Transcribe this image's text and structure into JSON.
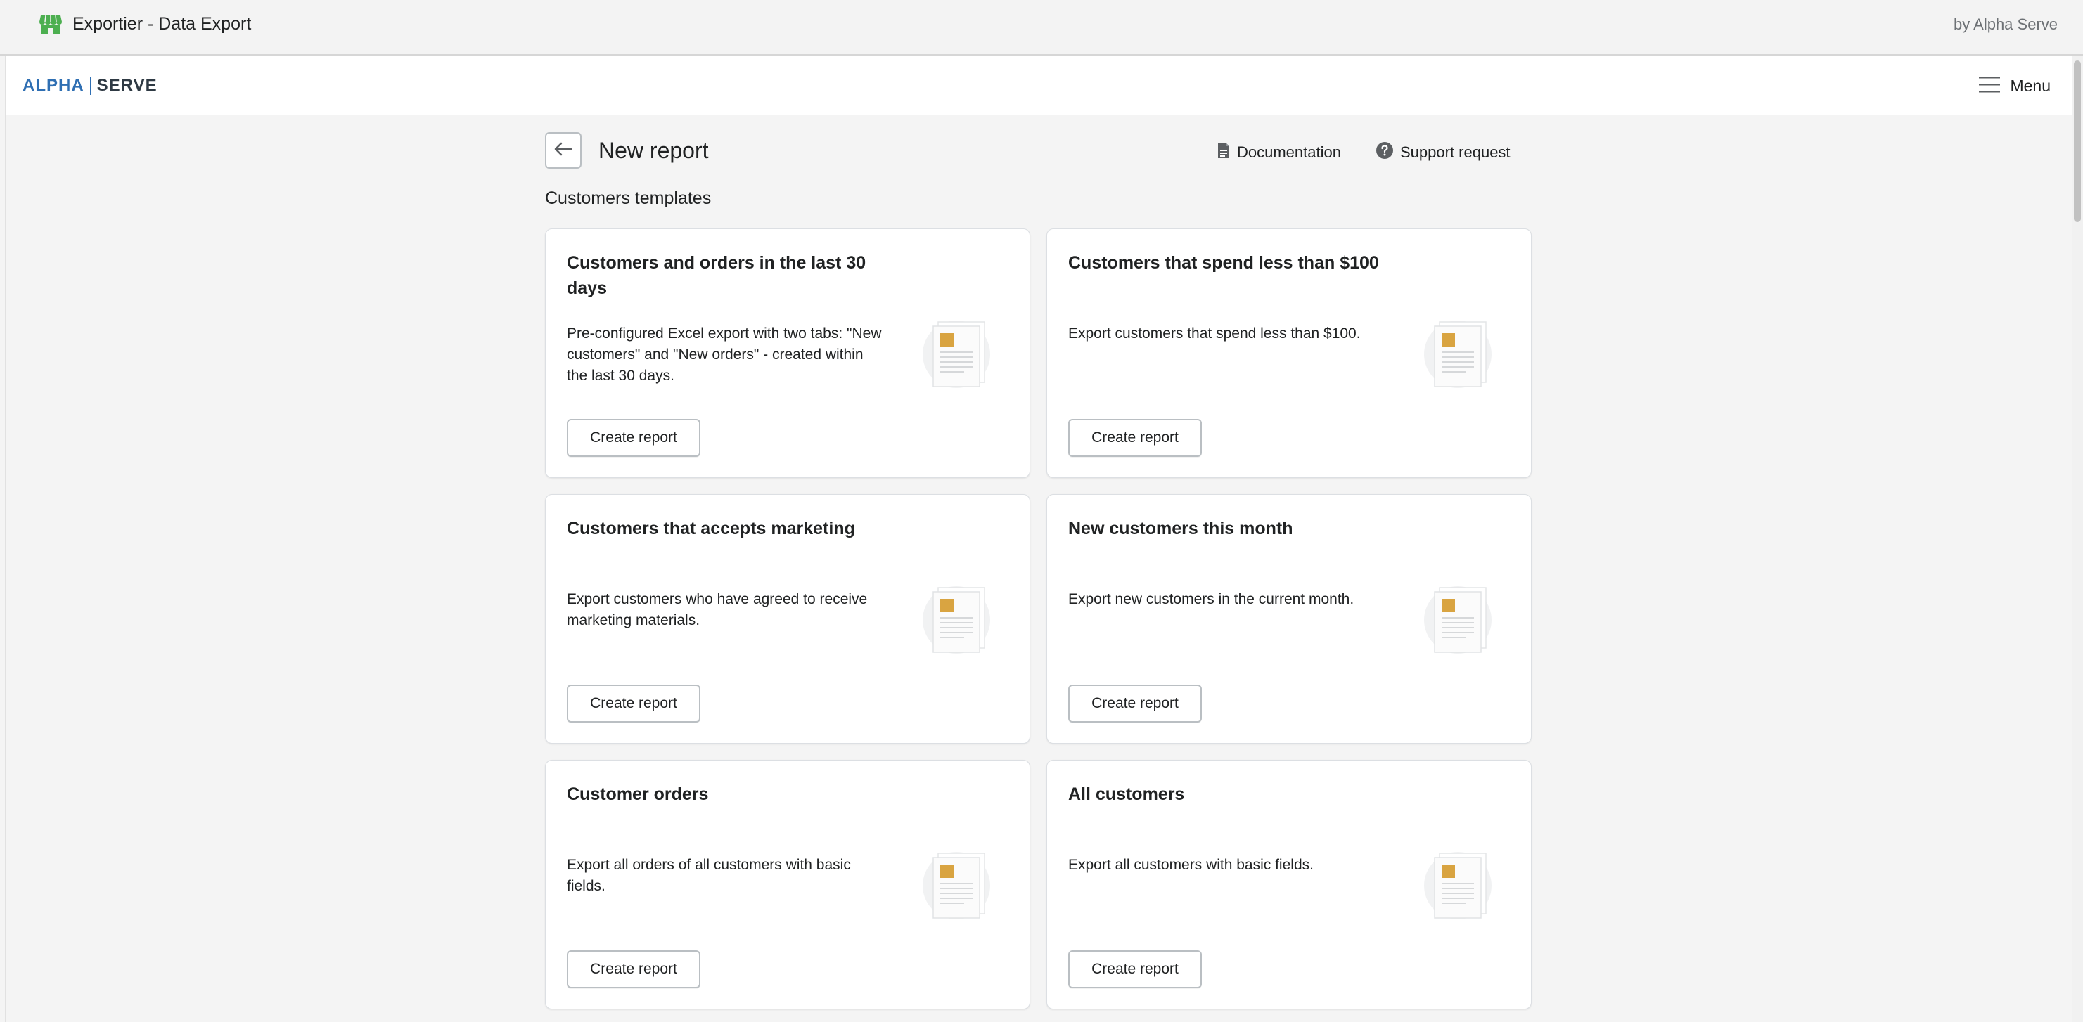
{
  "appbar": {
    "title": "Exportier - Data Export",
    "by": "by Alpha Serve",
    "icon": "store-icon"
  },
  "header": {
    "logo_left": "ALPHA",
    "logo_right": "SERVE",
    "menu_label": "Menu"
  },
  "page": {
    "title": "New report",
    "documentation_label": "Documentation",
    "support_label": "Support request",
    "section_title": "Customers templates"
  },
  "templates": [
    {
      "title": "Customers and orders in the last 30 days",
      "description": "Pre-configured Excel export with two tabs: \"New customers\" and \"New orders\" - created within the last 30 days.",
      "button": "Create report"
    },
    {
      "title": "Customers that spend less than $100",
      "description": "Export customers that spend less than $100.",
      "button": "Create report"
    },
    {
      "title": "Customers that accepts marketing",
      "description": "Export customers who have agreed to receive marketing materials.",
      "button": "Create report"
    },
    {
      "title": "New customers this month",
      "description": "Export new customers in the current month.",
      "button": "Create report"
    },
    {
      "title": "Customer orders",
      "description": "Export all orders of all customers with basic fields.",
      "button": "Create report"
    },
    {
      "title": "All customers",
      "description": "Export all customers with basic fields.",
      "button": "Create report"
    }
  ],
  "colors": {
    "accent_logo": "#2f6fb3",
    "store_icon": "#4caf50",
    "doc_thumb": "#d9a441"
  }
}
